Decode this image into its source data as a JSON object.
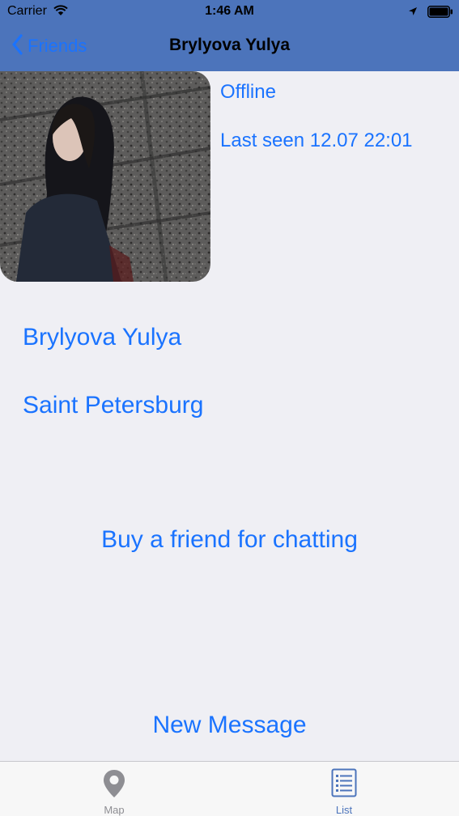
{
  "status_bar": {
    "carrier": "Carrier",
    "time": "1:46 AM",
    "icons": [
      "wifi-icon",
      "location-arrow-icon",
      "battery-icon"
    ]
  },
  "nav_bar": {
    "back_label": "Friends",
    "title": "Brylyova Yulya",
    "background_color": "#4c74bb",
    "accent_color": "#1a73ff"
  },
  "profile": {
    "status": "Offline",
    "last_seen": "Last seen 12.07 22:01",
    "name": "Brylyova Yulya",
    "city": "Saint Petersburg"
  },
  "actions": {
    "buy_friend_label": "Buy a friend for chatting",
    "new_message_label": "New Message"
  },
  "tab_bar": {
    "tabs": [
      {
        "label": "Map",
        "icon": "map-pin-icon",
        "selected": false
      },
      {
        "label": "List",
        "icon": "list-icon",
        "selected": true
      }
    ]
  }
}
